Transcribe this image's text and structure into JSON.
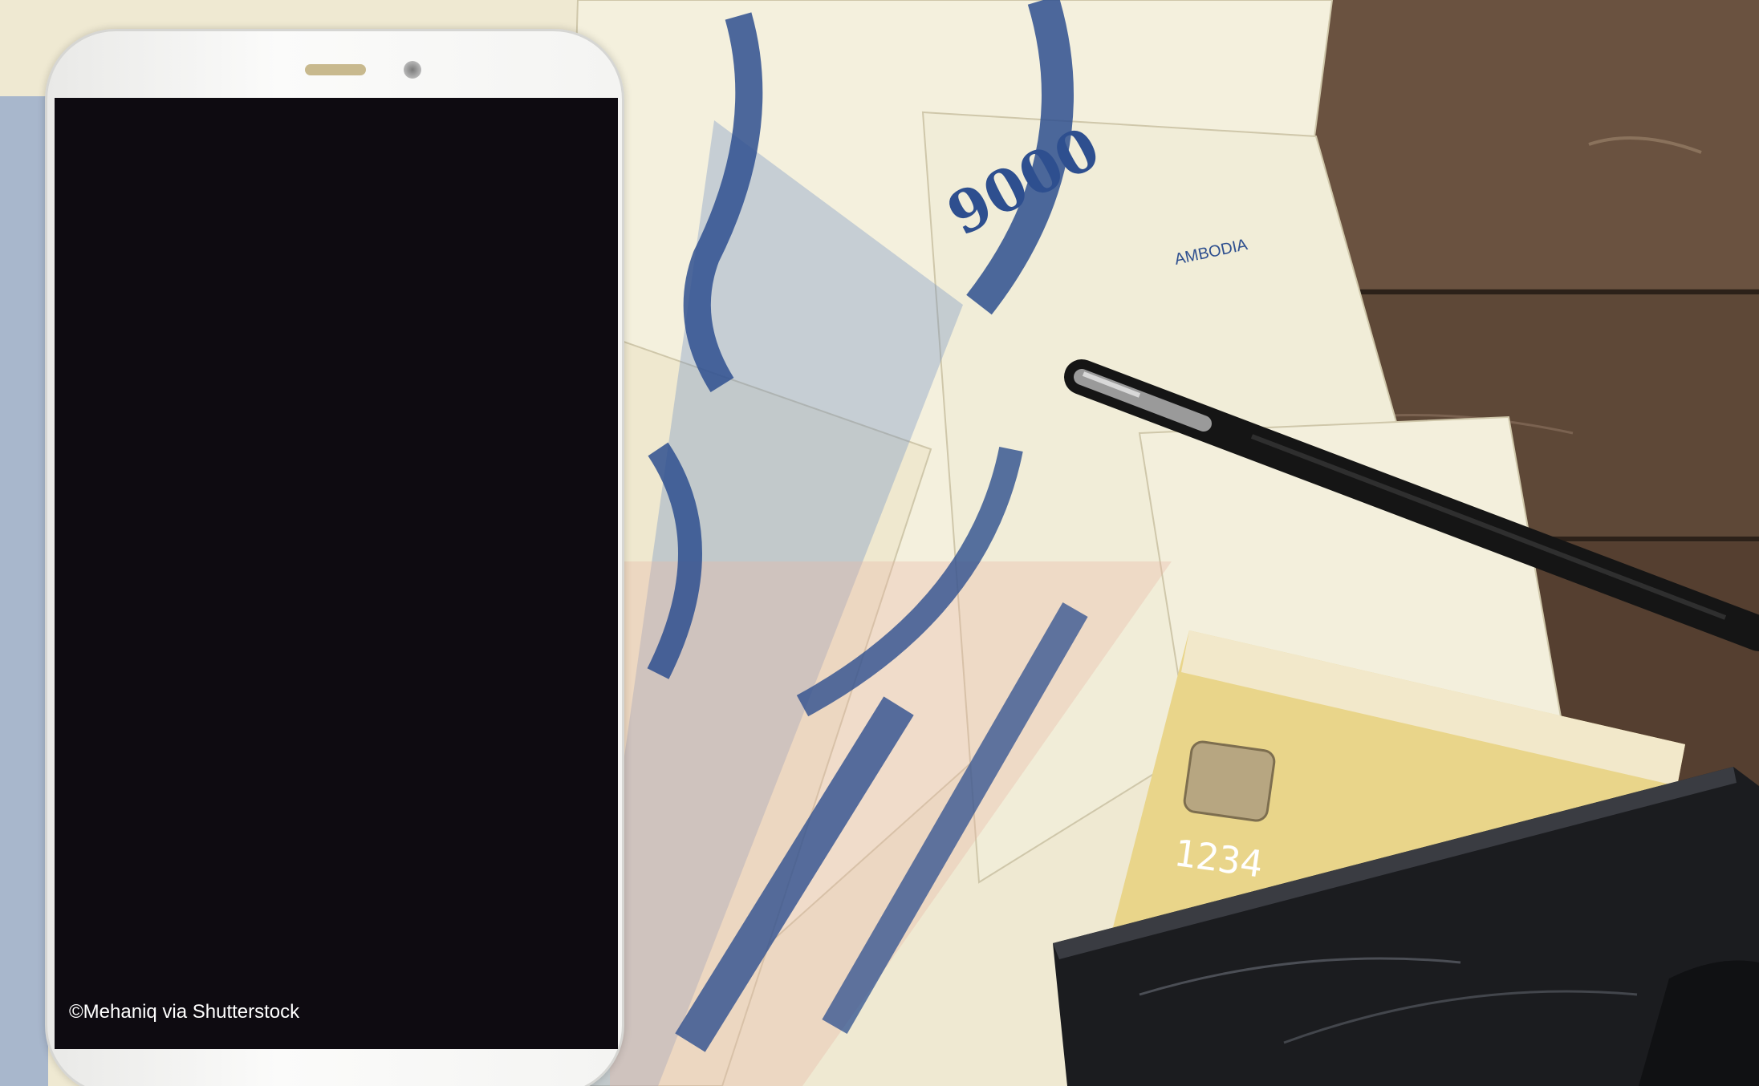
{
  "photo": {
    "credit": "©Mehaniq via Shutterstock",
    "banknote_value": "9000",
    "banknote_country_text": "AMBODIA",
    "card_number_text": "1234",
    "objects": [
      "smartphone",
      "banknotes",
      "pen",
      "credit-card",
      "wallet",
      "wooden-table"
    ]
  },
  "colors": {
    "wood": "#5a4635",
    "banknote_paper": "#f2eedb",
    "banknote_ink": "#2e4f8f",
    "card_gold": "#e9d58a",
    "wallet": "#1b1c1f",
    "phone_screen": "#0e0b11"
  }
}
